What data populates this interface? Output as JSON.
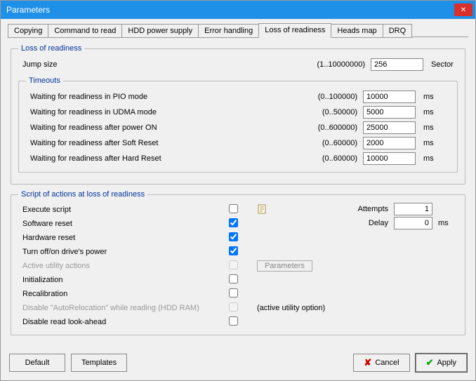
{
  "window": {
    "title": "Parameters"
  },
  "tabs": {
    "items": [
      {
        "label": "Copying"
      },
      {
        "label": "Command to read"
      },
      {
        "label": "HDD power supply"
      },
      {
        "label": "Error handling"
      },
      {
        "label": "Loss of readiness"
      },
      {
        "label": "Heads map"
      },
      {
        "label": "DRQ"
      }
    ],
    "active_index": 4
  },
  "loss_of_readiness": {
    "legend": "Loss of readiness",
    "jump": {
      "label": "Jump size",
      "range": "(1..10000000)",
      "value": "256",
      "unit": "Sector"
    }
  },
  "timeouts": {
    "legend": "Timeouts",
    "rows": [
      {
        "label": "Waiting for readiness in PIO mode",
        "range": "(0..100000)",
        "value": "10000",
        "unit": "ms"
      },
      {
        "label": "Waiting for readiness in UDMA mode",
        "range": "(0..50000)",
        "value": "5000",
        "unit": "ms"
      },
      {
        "label": "Waiting for readiness after power ON",
        "range": "(0..600000)",
        "value": "25000",
        "unit": "ms"
      },
      {
        "label": "Waiting for readiness after Soft Reset",
        "range": "(0..60000)",
        "value": "2000",
        "unit": "ms"
      },
      {
        "label": "Waiting for readiness after Hard Reset",
        "range": "(0..60000)",
        "value": "10000",
        "unit": "ms"
      }
    ]
  },
  "script": {
    "legend": "Script of actions at loss of readiness",
    "attempts": {
      "label": "Attempts",
      "value": "1"
    },
    "delay": {
      "label": "Delay",
      "value": "0",
      "unit": "ms"
    },
    "parameters_btn": "Parameters",
    "active_utility_option": "(active utility option)",
    "items": [
      {
        "label": "Execute script",
        "checked": false,
        "disabled": false,
        "has_icon": true
      },
      {
        "label": "Software reset",
        "checked": true,
        "disabled": false
      },
      {
        "label": "Hardware reset",
        "checked": true,
        "disabled": false
      },
      {
        "label": "Turn off/on drive's power",
        "checked": true,
        "disabled": false
      },
      {
        "label": "Active utility actions",
        "checked": false,
        "disabled": true,
        "has_param_btn": true
      },
      {
        "label": "Initialization",
        "checked": false,
        "disabled": false
      },
      {
        "label": "Recalibration",
        "checked": false,
        "disabled": false
      },
      {
        "label": "Disable \"AutoRelocation\" while reading (HDD RAM)",
        "checked": false,
        "disabled": true,
        "extra": "(active utility option)"
      },
      {
        "label": "Disable read look-ahead",
        "checked": false,
        "disabled": false
      }
    ]
  },
  "footer": {
    "default": "Default",
    "templates": "Templates",
    "cancel": "Cancel",
    "apply": "Apply"
  }
}
